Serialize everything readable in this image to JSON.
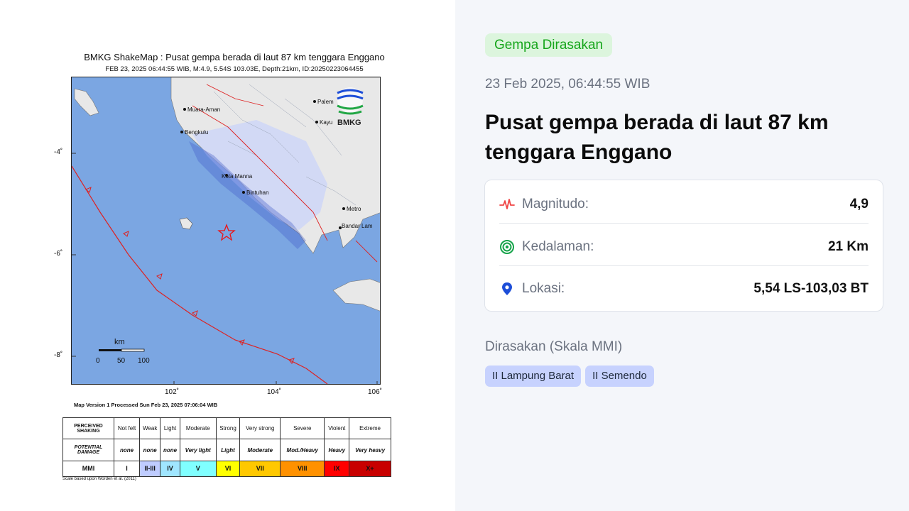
{
  "map": {
    "title": "BMKG ShakeMap : Pusat gempa berada di laut 87 km tenggara Enggano",
    "subtitle": "FEB 23, 2025 06:44:55 WIB, M:4.9, 5.54S 103.03E, Depth:21km, ID:20250223064455",
    "lat_labels": [
      "-4˚",
      "-6˚",
      "-8˚"
    ],
    "lon_labels": [
      "102˚",
      "104˚",
      "106˚"
    ],
    "cities": [
      "Muara-Aman",
      "Bengkulu",
      "Palem",
      "Kayu",
      "Kota Manna",
      "Bintuhan",
      "Metro",
      "Bandar Lam"
    ],
    "logo_text": "BMKG",
    "scale_bar": {
      "unit": "km",
      "ticks": [
        "0",
        "50",
        "100"
      ]
    },
    "version_text": "Map Version 1 Processed Sun Feb 23, 2025 07:06:04 WIB",
    "scale_note": "Scale based upon Worden et al. (2011)",
    "legend": {
      "shaking_header": "PERCEIVED SHAKING",
      "damage_header": "POTENTIAL DAMAGE",
      "mmi_header": "MMI",
      "shaking": [
        "Not felt",
        "Weak",
        "Light",
        "Moderate",
        "Strong",
        "Very strong",
        "Severe",
        "Violent",
        "Extreme"
      ],
      "damage": [
        "none",
        "none",
        "none",
        "Very light",
        "Light",
        "Moderate",
        "Mod./Heavy",
        "Heavy",
        "Very heavy"
      ],
      "mmi": [
        "I",
        "II-III",
        "IV",
        "V",
        "VI",
        "VII",
        "VIII",
        "IX",
        "X+"
      ],
      "colors": [
        "#ffffff",
        "#bfccff",
        "#a0e6ff",
        "#80ffff",
        "#ffff00",
        "#ffc800",
        "#ff9100",
        "#ff0000",
        "#c80000"
      ]
    }
  },
  "panel": {
    "badge": "Gempa Dirasakan",
    "datetime": "23 Feb 2025, 06:44:55 WIB",
    "headline": "Pusat gempa berada di laut 87 km tenggara Enggano",
    "rows": [
      {
        "icon": "magnitude-pulse-icon",
        "label": "Magnitudo:",
        "value": "4,9"
      },
      {
        "icon": "depth-target-icon",
        "label": "Kedalaman:",
        "value": "21 Km"
      },
      {
        "icon": "location-pin-icon",
        "label": "Lokasi:",
        "value": "5,54 LS-103,03 BT"
      }
    ],
    "felt_title": "Dirasakan (Skala MMI)",
    "felt": [
      "II Lampung Barat",
      "II Semendo"
    ],
    "colors": {
      "badge_bg": "#dcf5dd",
      "badge_text": "#17a61c",
      "chip_bg": "#c7d2fe",
      "pulse": "#ef4444",
      "target": "#16a34a",
      "pin": "#1d4ed8"
    }
  }
}
